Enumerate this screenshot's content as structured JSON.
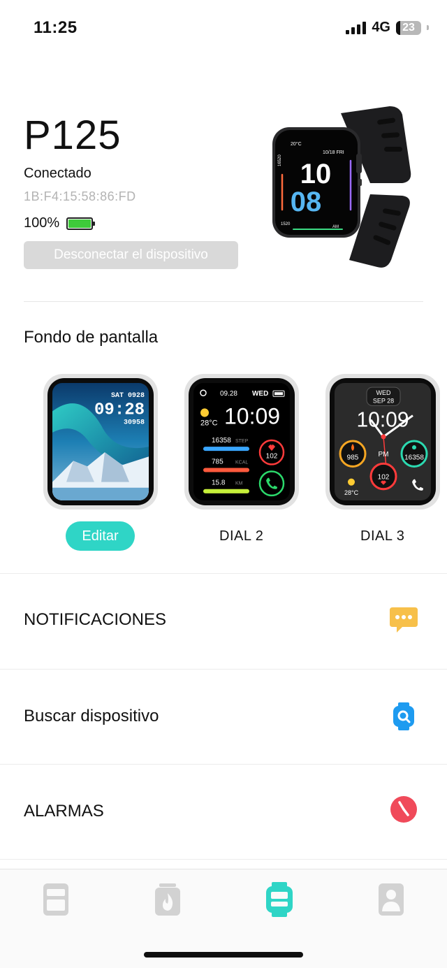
{
  "status_bar": {
    "time": "11:25",
    "network": "4G",
    "battery": "23"
  },
  "device": {
    "name": "P125",
    "status": "Conectado",
    "mac": "1B:F4:15:58:86:FD",
    "battery_pct": "100%",
    "battery_level": 1.0,
    "disconnect_label": "Desconectar el dispositivo"
  },
  "hero_watch": {
    "temp": "20°C",
    "date": "10/18 FRI",
    "hour": "10",
    "minute": "08",
    "am": "AM",
    "left_num": "16520",
    "bottom_num": "1520"
  },
  "wallpaper": {
    "title": "Fondo de pantalla",
    "edit_label": "Editar",
    "dial1": {
      "date": "SAT 0928",
      "time": "09:28",
      "steps": "30958"
    },
    "dial2": {
      "label": "DIAL 2",
      "date": "09.28",
      "day": "WED",
      "temp": "28°C",
      "time": "10:09",
      "steps": "16358",
      "steps_unit": "STEP",
      "kcal": "785",
      "kcal_unit": "KCAL",
      "km": "15.8",
      "km_unit": "KM",
      "heart": "102"
    },
    "dial3": {
      "label": "DIAL 3",
      "day": "WED",
      "date": "SEP 28",
      "time": "10:09",
      "kcal": "985",
      "steps": "16358",
      "pm": "PM",
      "heart": "102",
      "temp": "28°C"
    }
  },
  "menu": [
    {
      "label": "NOTIFICACIONES",
      "icon": "chat-bubble-icon",
      "color": "#f7c04a"
    },
    {
      "label": "Buscar dispositivo",
      "icon": "watch-search-icon",
      "color": "#1e9bf0"
    },
    {
      "label": "ALARMAS",
      "icon": "clock-icon",
      "color": "#f04a5a"
    }
  ],
  "tabs": [
    {
      "name": "tab-dashboard",
      "icon": "dashboard-icon",
      "active": false
    },
    {
      "name": "tab-activity",
      "icon": "flame-icon",
      "active": false
    },
    {
      "name": "tab-device",
      "icon": "watch-icon",
      "active": true
    },
    {
      "name": "tab-profile",
      "icon": "person-icon",
      "active": false
    }
  ],
  "colors": {
    "accent": "#2fd5c6",
    "inactive_tab": "#d2d2d2",
    "battery_green": "#3ecb3a"
  }
}
